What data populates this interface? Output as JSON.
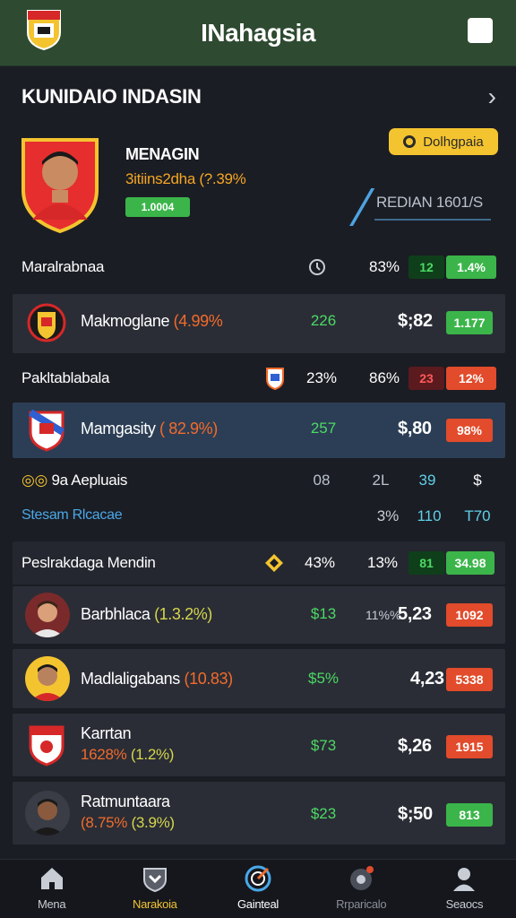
{
  "header": {
    "title": "INahagsia"
  },
  "section": {
    "title": "KUNIDAIO INDASIN"
  },
  "hero": {
    "name": "MENAGIN",
    "subtitle": "3itiins2dha (?.39%",
    "badge": "1.0004",
    "chip": "Dolhgpaia",
    "stat": "REDIAN 1601/S"
  },
  "rows": [
    {
      "label": "Maralrabnaa",
      "c1": "83%",
      "c2": "12",
      "c3": "1.4%"
    },
    {
      "label": "Pakltablabala",
      "c1": "23%",
      "c2": "86%",
      "c3": "23",
      "c4": "12%"
    }
  ],
  "cards": [
    {
      "name": "Makmoglane",
      "change": "(4.99%",
      "pct": "226",
      "value": "$;82",
      "pill": "1.177"
    },
    {
      "name": "Mamgasity",
      "change": "( 82.9%)",
      "pct": "257",
      "value": "$,80",
      "pill": "98%"
    }
  ],
  "stats_block": {
    "label1": "9a Aepluais",
    "label2": "Stesam Rlcacae",
    "r1": [
      "08",
      "2L",
      "39",
      "$"
    ],
    "r2": [
      "3%",
      "110",
      "T70"
    ]
  },
  "row3": {
    "label": "Peslrakdaga Mendin",
    "c1": "43%",
    "c2": "13%",
    "c3": "81",
    "c4": "34.98"
  },
  "players": [
    {
      "name": "Barbhlaca",
      "change": "(1.3.2%)",
      "pct": "$13",
      "pre": "11%%",
      "value": "5,23",
      "pill": "1092"
    },
    {
      "name": "Madlaligabans",
      "change": "(10.83)",
      "pct": "$5%",
      "value": "4,23",
      "pill": "5338"
    },
    {
      "name": "Karrtan",
      "change": "1628%",
      "change2": "(1.2%)",
      "pct": "$73",
      "value": "$,26",
      "pill": "1915"
    },
    {
      "name": "Ratmuntaara",
      "change": "(8.75%",
      "change2": "(3.9%)",
      "pct": "$23",
      "value": "$;50",
      "pill": "813"
    }
  ],
  "nav": [
    {
      "label": "Mena",
      "icon": "home-icon"
    },
    {
      "label": "Narakoia",
      "icon": "shield-icon"
    },
    {
      "label": "Gainteal",
      "icon": "target-icon"
    },
    {
      "label": "Rrparicalo",
      "icon": "settings-icon"
    },
    {
      "label": "Seaocs",
      "icon": "user-icon"
    }
  ],
  "colors": {
    "topbar": "#2e4a31",
    "background": "#1b1d24",
    "accent_green": "#3bb54a",
    "accent_red": "#e24b2b",
    "accent_yellow": "#f4c430"
  }
}
